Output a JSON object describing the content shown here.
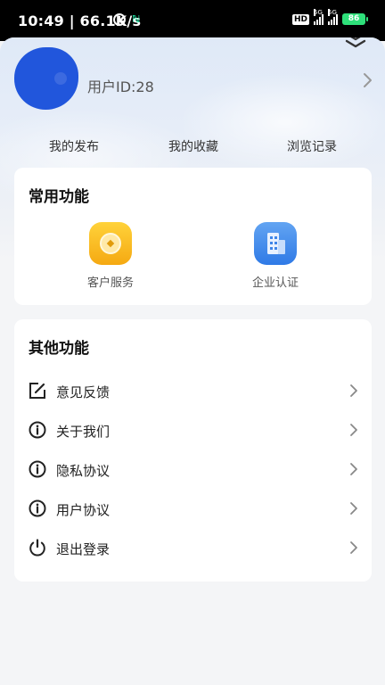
{
  "status_bar": {
    "time": "10:49",
    "speed": "66.1K/s",
    "network_badge": "HD",
    "signal_label": "5G",
    "battery": "86",
    "accent": "#2ee07a"
  },
  "profile": {
    "user_id": "用户ID:28",
    "avatar_color": "#2156dc"
  },
  "quick_links": [
    "我的发布",
    "我的收藏",
    "浏览记录"
  ],
  "common_section": {
    "title": "常用功能",
    "items": [
      {
        "label": "客户服务",
        "icon": "coin-icon"
      },
      {
        "label": "企业认证",
        "icon": "building-icon"
      }
    ]
  },
  "other_section": {
    "title": "其他功能",
    "items": [
      {
        "label": "意见反馈",
        "icon": "edit-icon"
      },
      {
        "label": "关于我们",
        "icon": "info-icon"
      },
      {
        "label": "隐私协议",
        "icon": "info-icon"
      },
      {
        "label": "用户协议",
        "icon": "info-icon"
      },
      {
        "label": "退出登录",
        "icon": "power-icon"
      }
    ]
  }
}
